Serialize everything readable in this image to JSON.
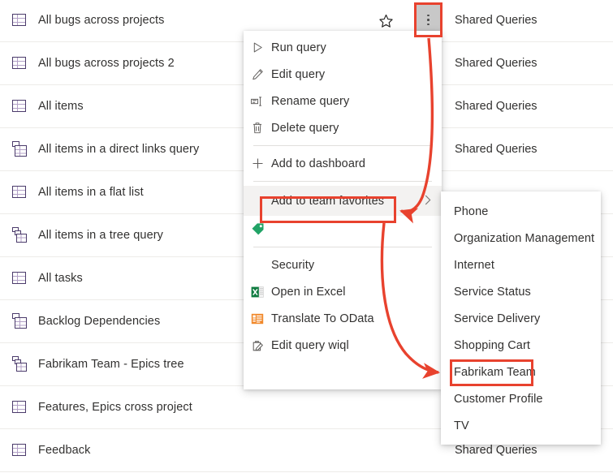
{
  "query_list": {
    "folder_label": "Shared Queries",
    "rows": [
      {
        "name": "All bugs across projects",
        "icon": "flat-grid-icon",
        "folder": "Shared Queries"
      },
      {
        "name": "All bugs across projects 2",
        "icon": "flat-grid-icon",
        "folder": "Shared Queries"
      },
      {
        "name": "All items",
        "icon": "flat-grid-icon",
        "folder": "Shared Queries"
      },
      {
        "name": "All items in a direct links query",
        "icon": "direct-links-icon",
        "folder": "Shared Queries"
      },
      {
        "name": "All items in a flat list",
        "icon": "flat-grid-icon",
        "folder": ""
      },
      {
        "name": "All items in a tree query",
        "icon": "tree-query-icon",
        "folder": ""
      },
      {
        "name": "All tasks",
        "icon": "flat-grid-icon",
        "folder": ""
      },
      {
        "name": "Backlog Dependencies",
        "icon": "direct-links-icon",
        "folder": ""
      },
      {
        "name": "Fabrikam Team - Epics tree",
        "icon": "tree-query-icon",
        "folder": ""
      },
      {
        "name": "Features, Epics cross project",
        "icon": "flat-grid-icon",
        "folder": ""
      },
      {
        "name": "Feedback",
        "icon": "flat-grid-icon",
        "folder": "Shared Queries"
      }
    ]
  },
  "row_toolbar": {
    "favorite_icon": "star-outline-icon",
    "more_actions_icon": "more-actions-ellipsis-icon"
  },
  "context_menu": {
    "items": [
      {
        "label": "Run query",
        "icon": "play-triangle-icon",
        "has_submenu": false
      },
      {
        "label": "Edit query",
        "icon": "pencil-icon",
        "has_submenu": false
      },
      {
        "label": "Rename query",
        "icon": "rename-icon",
        "has_submenu": false
      },
      {
        "label": "Delete query",
        "icon": "trash-can-icon",
        "has_submenu": false
      },
      {
        "label": "Add to dashboard",
        "icon": "plus-icon",
        "has_submenu": false
      },
      {
        "label": "Add to team favorites",
        "icon": "",
        "has_submenu": true
      },
      {
        "label": "",
        "icon": "green-tag-icon",
        "has_submenu": false
      },
      {
        "label": "Security",
        "icon": "",
        "has_submenu": false
      },
      {
        "label": "Open in Excel",
        "icon": "excel-icon",
        "has_submenu": false
      },
      {
        "label": "Translate To OData",
        "icon": "odata-icon",
        "has_submenu": false
      },
      {
        "label": "Edit query wiql",
        "icon": "edit-wiql-icon",
        "has_submenu": false
      }
    ],
    "submenu_chevron": "chevron-right-icon"
  },
  "team_favorites_submenu": {
    "items": [
      {
        "label": "Phone"
      },
      {
        "label": "Organization Management"
      },
      {
        "label": "Internet"
      },
      {
        "label": "Service Status"
      },
      {
        "label": "Service Delivery"
      },
      {
        "label": "Shopping Cart"
      },
      {
        "label": "Fabrikam Team"
      },
      {
        "label": "Customer Profile"
      },
      {
        "label": "TV"
      }
    ]
  },
  "annotations": {
    "accent_color": "#e8422e",
    "highlight_more_actions": "more-actions-ellipsis-icon",
    "highlight_add_to_team_favorites": "Add to team favorites",
    "highlight_fabrikam_team": "Fabrikam Team"
  }
}
